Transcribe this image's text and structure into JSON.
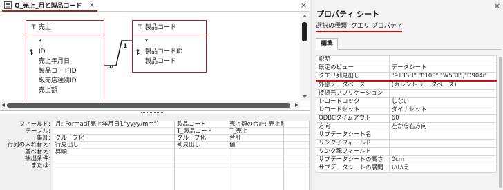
{
  "document": {
    "tab_title": "Q_売上_月と製品コード",
    "tab_close": "×",
    "window_close": "×"
  },
  "diagram": {
    "tables": [
      {
        "title": "T_売上",
        "fields": [
          {
            "name": "*",
            "key": false
          },
          {
            "name": "ID",
            "key": true
          },
          {
            "name": "売上年月日",
            "key": false
          },
          {
            "name": "製品コードID",
            "key": false
          },
          {
            "name": "販売店種別ID",
            "key": false
          },
          {
            "name": "売上額",
            "key": false
          }
        ]
      },
      {
        "title": "T_製品コード",
        "fields": [
          {
            "name": "*",
            "key": false
          },
          {
            "name": "製品コードID",
            "key": true
          },
          {
            "name": "製品コード",
            "key": false
          }
        ]
      }
    ],
    "relationship": {
      "one_side": "1",
      "many_side": "∞"
    }
  },
  "grid": {
    "row_labels": [
      "フィールド:",
      "テーブル:",
      "集計:",
      "行列の入れ替え:",
      "並べ替え:",
      "抽出条件:",
      "または:"
    ],
    "columns": [
      {
        "cells": [
          "月: Format([売上年月日],\"yyyy/mm\")",
          "",
          "グループ化",
          "行見出し",
          "昇順",
          "",
          ""
        ]
      },
      {
        "cells": [
          "製品コード",
          "T_製品コード",
          "グループ化",
          "列見出し",
          "",
          "",
          ""
        ]
      },
      {
        "cells": [
          "売上額の合計: 売上額",
          "T_売上",
          "合計",
          "値",
          "",
          "",
          ""
        ]
      },
      {
        "cells": [
          "",
          "",
          "",
          "",
          "",
          "",
          ""
        ]
      }
    ]
  },
  "property_sheet": {
    "title": "プロパティ シート",
    "close": "×",
    "selection_type": "選択の種類: クエリ プロパティ",
    "tab": "標準",
    "rows": [
      {
        "name": "説明",
        "value": ""
      },
      {
        "name": "既定のビュー",
        "value": "データシート"
      },
      {
        "name": "クエリ列見出し",
        "value": "\"913SH\",\"810P\",\"W53T\",\"D904i\"",
        "highlighted": true
      },
      {
        "name": "外部データベース",
        "value": "(カレント データベース)"
      },
      {
        "name": "接続元アプリケーション",
        "value": ""
      },
      {
        "name": "レコードロック",
        "value": "しない"
      },
      {
        "name": "レコードセット",
        "value": "ダイナセット"
      },
      {
        "name": "ODBCタイムアウト",
        "value": "60"
      },
      {
        "name": "方向",
        "value": "左から右方向"
      },
      {
        "name": "サブデータシート名",
        "value": ""
      },
      {
        "name": "リンク子フィールド",
        "value": ""
      },
      {
        "name": "リンク親フィールド",
        "value": ""
      },
      {
        "name": "サブデータシートの高さ",
        "value": "0cm"
      },
      {
        "name": "サブデータシートの展開",
        "value": "いいえ"
      }
    ]
  },
  "colors": {
    "accent": "#d10a12",
    "table_border": "#b81c22"
  }
}
